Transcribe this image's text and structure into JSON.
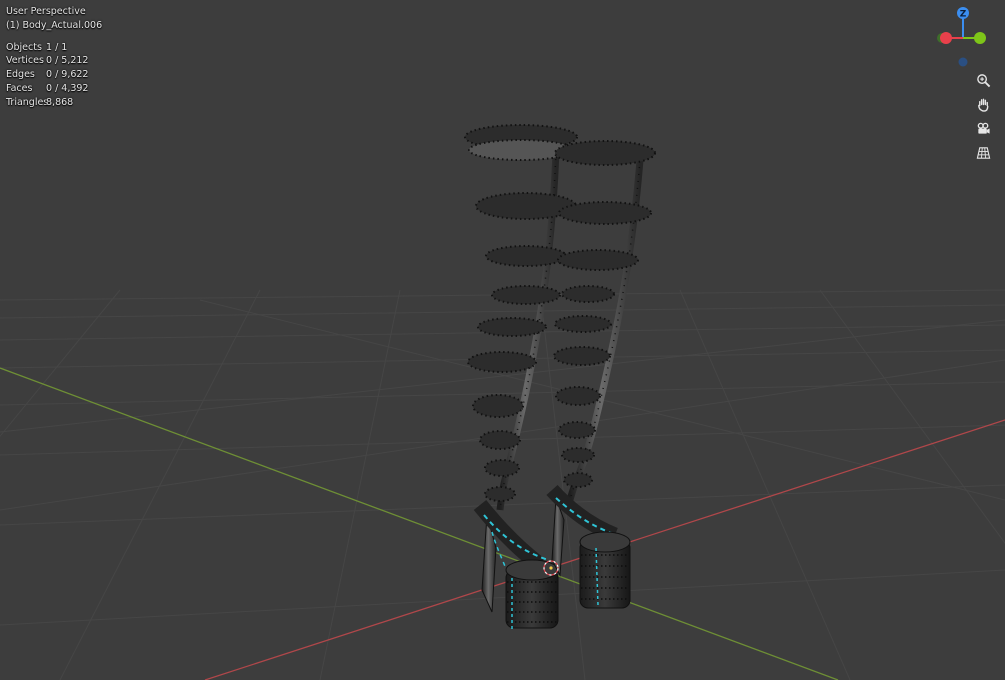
{
  "viewport": {
    "perspective_label": "User Perspective",
    "active_object": "(1) Body_Actual.006"
  },
  "statistics": [
    {
      "label": "Objects",
      "value": "1 / 1"
    },
    {
      "label": "Vertices",
      "value": "0 / 5,212"
    },
    {
      "label": "Edges",
      "value": "0 / 9,622"
    },
    {
      "label": "Faces",
      "value": "0 / 4,392"
    },
    {
      "label": "Triangles",
      "value": "8,868"
    }
  ],
  "gizmo": {
    "z_label": "Z",
    "x_color": "#e8404b",
    "y_color": "#7ec519",
    "z_color": "#3b8ef0"
  },
  "nav_icons": [
    "zoom-icon",
    "hand-pan-icon",
    "camera-icon",
    "grid-ortho-icon"
  ],
  "colors": {
    "background": "#3d3d3d",
    "grid": "#484848",
    "x_axis": "#b0474a",
    "y_axis": "#6e8f35",
    "seam_highlight": "#2fc4d6"
  }
}
